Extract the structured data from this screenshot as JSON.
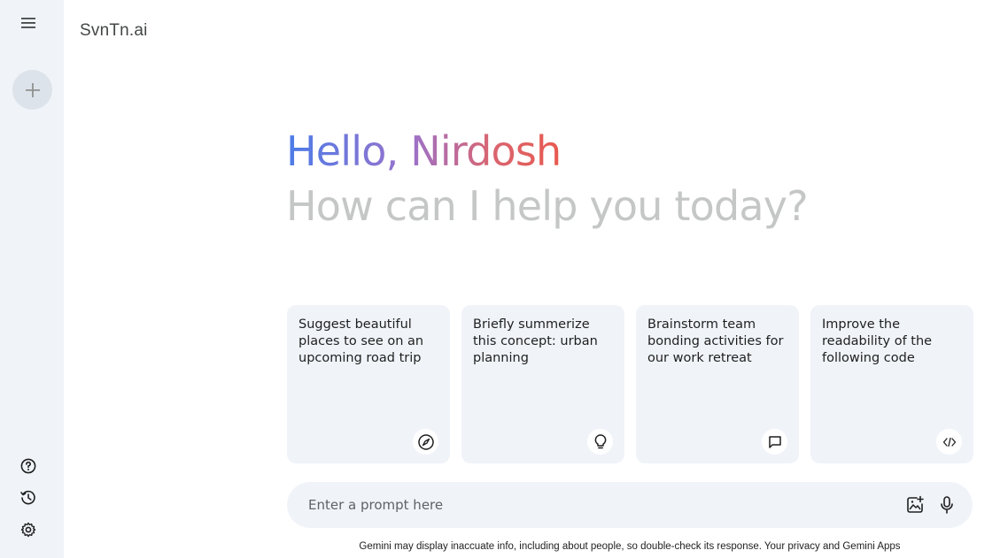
{
  "app": {
    "brand": "SvnTn.ai"
  },
  "sidebar": {
    "icons": [
      "menu-icon",
      "plus-icon",
      "help-icon",
      "history-icon",
      "settings-icon"
    ]
  },
  "greeting": {
    "hello": "Hello, Nirdosh",
    "subtitle": "How can I help you today?"
  },
  "cards": [
    {
      "text": "Suggest beautiful places to see on an upcoming road trip",
      "icon": "compass-icon"
    },
    {
      "text": "Briefly summerize this concept: urban planning",
      "icon": "lightbulb-icon"
    },
    {
      "text": "Brainstorm team bonding activities for our work retreat",
      "icon": "chat-icon"
    },
    {
      "text": "Improve the readability of the following code",
      "icon": "code-icon"
    }
  ],
  "prompt": {
    "placeholder": "Enter a prompt here",
    "icons": [
      "add-image-icon",
      "microphone-icon"
    ]
  },
  "footer": {
    "disclaimer": "Gemini may display inaccuate info, including about people, so double-check its response. Your privacy and Gemini Apps"
  },
  "colors": {
    "sidebar_bg": "#f0f4f9",
    "card_bg": "#f0f4f9",
    "gradient_start": "#4b7ce8",
    "gradient_end": "#e85a4f",
    "subtitle": "#c4c7c5"
  }
}
